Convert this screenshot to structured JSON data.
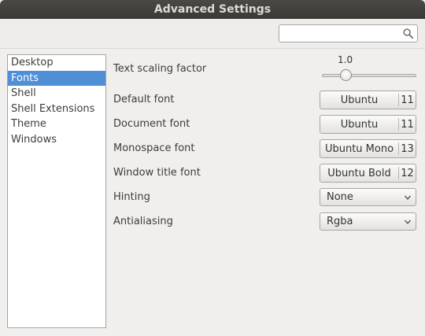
{
  "window": {
    "title": "Advanced Settings"
  },
  "search": {
    "value": "",
    "placeholder": ""
  },
  "sidebar": {
    "items": [
      {
        "label": "Desktop"
      },
      {
        "label": "Fonts"
      },
      {
        "label": "Shell"
      },
      {
        "label": "Shell Extensions"
      },
      {
        "label": "Theme"
      },
      {
        "label": "Windows"
      }
    ],
    "selected": "Fonts"
  },
  "fonts": {
    "text_scaling": {
      "label": "Text scaling factor",
      "value": "1.0",
      "slider_fraction": 0.22
    },
    "default_font": {
      "label": "Default font",
      "name": "Ubuntu",
      "size": "11"
    },
    "document_font": {
      "label": "Document font",
      "name": "Ubuntu",
      "size": "11"
    },
    "monospace_font": {
      "label": "Monospace font",
      "name": "Ubuntu Mono",
      "size": "13"
    },
    "window_title_font": {
      "label": "Window title font",
      "name": "Ubuntu Bold",
      "size": "12"
    },
    "hinting": {
      "label": "Hinting",
      "value": "None"
    },
    "antialiasing": {
      "label": "Antialiasing",
      "value": "Rgba"
    }
  },
  "colors": {
    "selection": "#4f8fd6",
    "titlebar": "#3c3b37"
  }
}
